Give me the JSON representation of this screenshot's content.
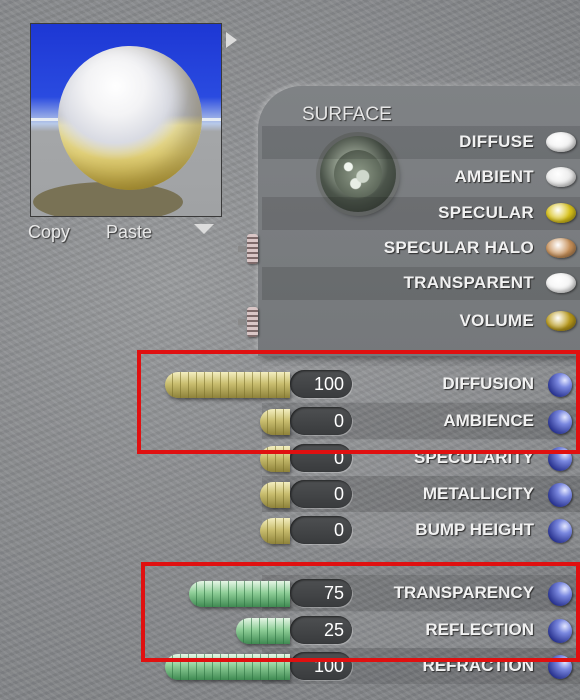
{
  "preview": {
    "copy_label": "Copy",
    "paste_label": "Paste"
  },
  "surface": {
    "title": "SURFACE",
    "channels": [
      {
        "label": "DIFFUSE",
        "color": "#f2f2f2"
      },
      {
        "label": "AMBIENT",
        "color": "#ececec"
      },
      {
        "label": "SPECULAR",
        "color": "#d9c21a"
      },
      {
        "label": "SPECULAR HALO",
        "color": "#c8915a"
      },
      {
        "label": "TRANSPARENT",
        "color": "#f4f4f4"
      },
      {
        "label": "VOLUME",
        "color": "#b99a1c"
      }
    ]
  },
  "parameters": [
    {
      "label": "DIFFUSION",
      "value": "100",
      "track": "gold",
      "level": 100
    },
    {
      "label": "AMBIENCE",
      "value": "0",
      "track": "gold",
      "level": 0
    },
    {
      "label": "SPECULARITY",
      "value": "0",
      "track": "gold",
      "level": 0
    },
    {
      "label": "METALLICITY",
      "value": "0",
      "track": "gold",
      "level": 0
    },
    {
      "label": "BUMP HEIGHT",
      "value": "0",
      "track": "gold",
      "level": 0
    },
    {
      "label": "TRANSPARENCY",
      "value": "75",
      "track": "green",
      "level": 75
    },
    {
      "label": "REFLECTION",
      "value": "25",
      "track": "green",
      "level": 25
    },
    {
      "label": "REFRACTION",
      "value": "100",
      "track": "green",
      "level": 100
    }
  ],
  "colors": {
    "highlight": "#e01010",
    "orb_button": "#3a46b8"
  }
}
